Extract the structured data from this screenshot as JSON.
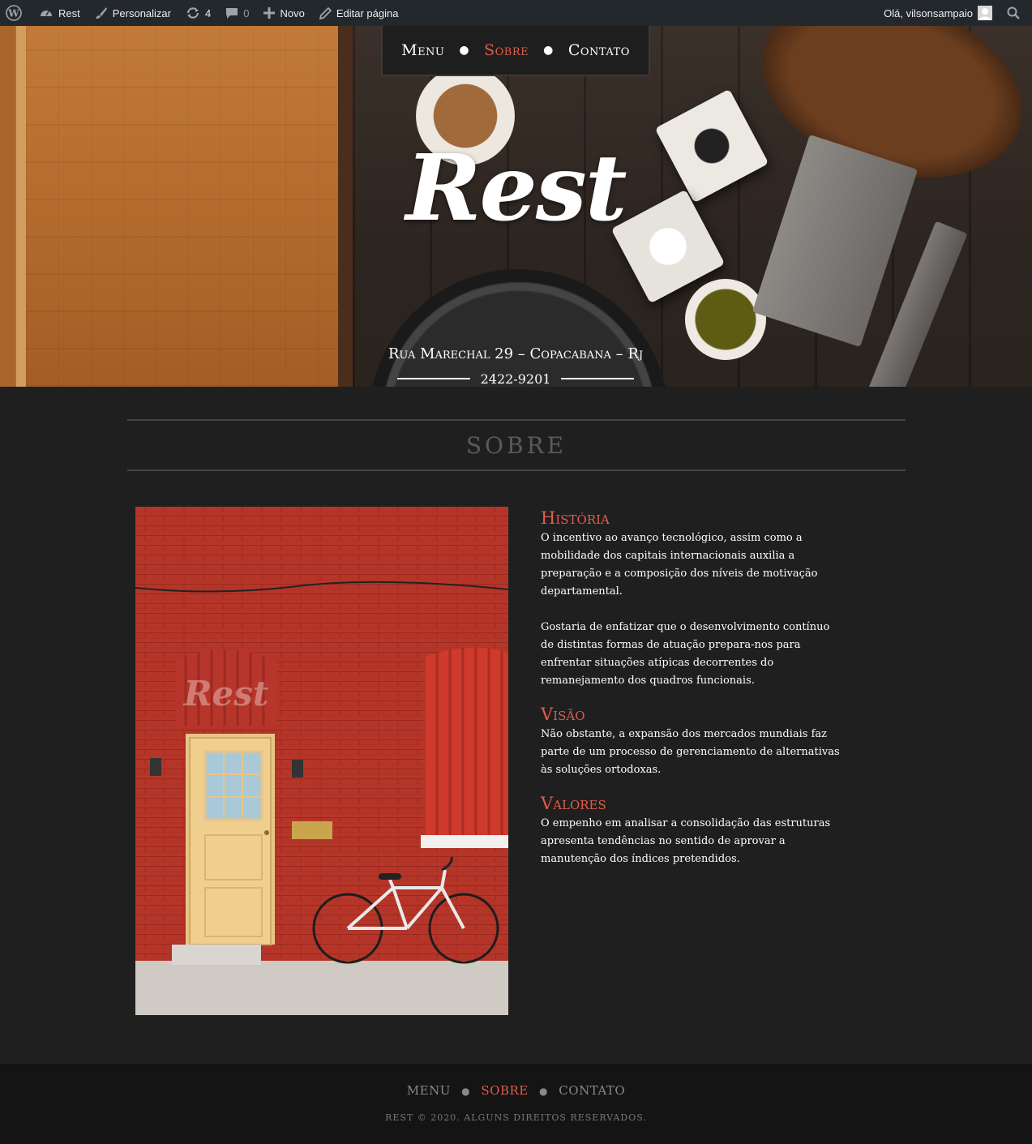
{
  "adminbar": {
    "site_name": "Rest",
    "customize": "Personalizar",
    "updates_count": "4",
    "comments_count": "0",
    "new_label": "Novo",
    "edit_page": "Editar página",
    "greeting": "Olá, vilsonsampaio"
  },
  "nav": {
    "items": [
      {
        "label": "Menu",
        "active": false
      },
      {
        "label": "Sobre",
        "active": true
      },
      {
        "label": "Contato",
        "active": false
      }
    ]
  },
  "hero": {
    "logo": "Rest",
    "address": "Rua Marechal 29 – Copacabana – Rj",
    "phone": "2422-9201"
  },
  "section": {
    "title": "SOBRE",
    "photo_watermark": "Rest",
    "blocks": [
      {
        "heading": "História",
        "paragraphs": [
          "O incentivo ao avanço tecnológico, assim como a mobilidade dos capitais internacionais auxilia a preparação e a composição dos níveis de motivação departamental.",
          "Gostaria de enfatizar que o desenvolvimento contínuo de distintas formas de atuação prepara-nos para enfrentar situações atípicas decorrentes do remanejamento dos quadros funcionais."
        ]
      },
      {
        "heading": "Visão",
        "paragraphs": [
          "Não obstante, a expansão dos mercados mundiais faz parte de um processo de gerenciamento de alternativas às soluções ortodoxas."
        ]
      },
      {
        "heading": "Valores",
        "paragraphs": [
          "O empenho em analisar a consolidação das estruturas apresenta tendências no sentido de aprovar a manutenção dos índices pretendidos."
        ]
      }
    ]
  },
  "footer": {
    "nav": [
      "MENU",
      "SOBRE",
      "CONTATO"
    ],
    "active_index": 1,
    "copyright": "REST © 2020. ALGUNS DIREITOS RESERVADOS."
  },
  "colors": {
    "accent": "#e05d4c",
    "background": "#1f1f1f",
    "adminbar": "#23282d",
    "footer": "#141414"
  },
  "icons": [
    "wordpress-icon",
    "dashboard-icon",
    "brush-icon",
    "updates-icon",
    "comment-icon",
    "plus-icon",
    "pencil-icon",
    "avatar-icon",
    "search-icon"
  ]
}
